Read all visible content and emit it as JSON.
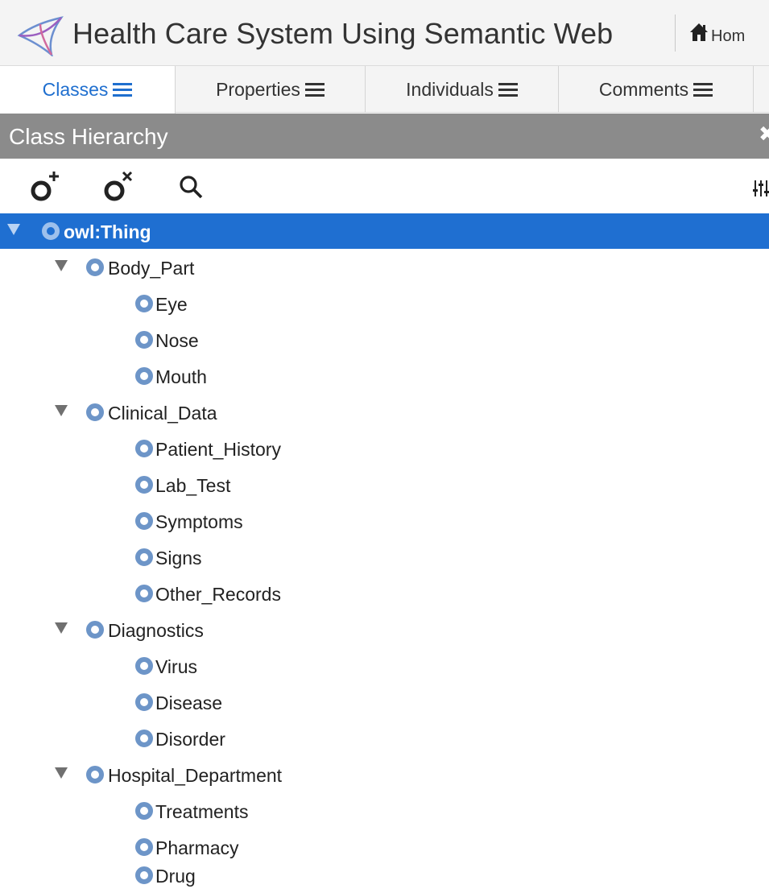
{
  "header": {
    "title": "Health Care System Using Semantic Web",
    "home_label": "Hom",
    "logo_icon": "triangle-knot-logo",
    "home_icon": "home-icon"
  },
  "tabs": [
    {
      "label": "Classes",
      "active": true
    },
    {
      "label": "Properties",
      "active": false
    },
    {
      "label": "Individuals",
      "active": false
    },
    {
      "label": "Comments",
      "active": false
    }
  ],
  "panel": {
    "title": "Class Hierarchy",
    "close_icon": "close-icon"
  },
  "toolbar": {
    "add_icon": "add-class-icon",
    "delete_icon": "delete-class-icon",
    "search_icon": "search-icon",
    "settings_icon": "settings-sliders-icon"
  },
  "tree": [
    {
      "label": "owl:Thing",
      "selected": true,
      "expanded": true,
      "children": [
        {
          "label": "Body_Part",
          "expanded": true,
          "children": [
            {
              "label": "Eye"
            },
            {
              "label": "Nose"
            },
            {
              "label": "Mouth"
            }
          ]
        },
        {
          "label": "Clinical_Data",
          "expanded": true,
          "children": [
            {
              "label": "Patient_History"
            },
            {
              "label": "Lab_Test"
            },
            {
              "label": "Symptoms"
            },
            {
              "label": "Signs"
            },
            {
              "label": "Other_Records"
            }
          ]
        },
        {
          "label": "Diagnostics",
          "expanded": true,
          "children": [
            {
              "label": "Virus"
            },
            {
              "label": "Disease"
            },
            {
              "label": "Disorder"
            }
          ]
        },
        {
          "label": "Hospital_Department",
          "expanded": true,
          "children": [
            {
              "label": "Treatments"
            },
            {
              "label": "Pharmacy"
            },
            {
              "label": "Drug"
            }
          ]
        }
      ]
    }
  ],
  "colors": {
    "accent": "#1f6fd1",
    "panel_heading": "#8b8b8b",
    "class_icon": "#6d95c8"
  }
}
